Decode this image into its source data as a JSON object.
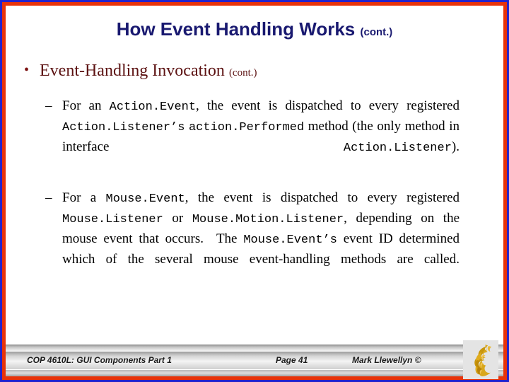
{
  "slide": {
    "title": {
      "main": "How Event Handling Works",
      "cont": "(cont.)"
    },
    "bullet_level1": {
      "marker": "•",
      "text": "Event-Handling Invocation",
      "cont": "(cont.)"
    },
    "bullets_level2": [
      {
        "marker": "–",
        "segments": [
          {
            "type": "text",
            "value": "For an "
          },
          {
            "type": "code",
            "value": "Action.Event"
          },
          {
            "type": "text",
            "value": ", the event is dispatched to every registered "
          },
          {
            "type": "code",
            "value": "Action.Listener’s"
          },
          {
            "type": "text",
            "value": " "
          },
          {
            "type": "code",
            "value": "action.Performed"
          },
          {
            "type": "text",
            "value": " method (the only method in interface "
          },
          {
            "type": "code",
            "value": "Action.Listener"
          },
          {
            "type": "text",
            "value": ")."
          }
        ]
      },
      {
        "marker": "–",
        "segments": [
          {
            "type": "text",
            "value": "For a "
          },
          {
            "type": "code",
            "value": "Mouse.Event"
          },
          {
            "type": "text",
            "value": ", the event is dispatched to every registered "
          },
          {
            "type": "code",
            "value": "Mouse.Listener"
          },
          {
            "type": "text",
            "value": " or "
          },
          {
            "type": "code",
            "value": "Mouse.Motion.Listener"
          },
          {
            "type": "text",
            "value": ", depending on the mouse event that occurs.  The "
          },
          {
            "type": "code",
            "value": "Mouse.Event’s"
          },
          {
            "type": "text",
            "value": " event ID determined which of the several mouse event-handling methods are called."
          }
        ]
      }
    ],
    "footer": {
      "course": "COP 4610L: GUI Components Part 1",
      "page": "Page 41",
      "author": "Mark Llewellyn ©"
    },
    "logo": {
      "name": "ucf-pegasus-logo"
    },
    "colors": {
      "frame_outer": "#2222cc",
      "frame_inner": "#e8330a",
      "title": "#191970",
      "bullet_level1": "#5c1212",
      "body_text": "#000000",
      "logo_gold": "#d4a017"
    }
  }
}
